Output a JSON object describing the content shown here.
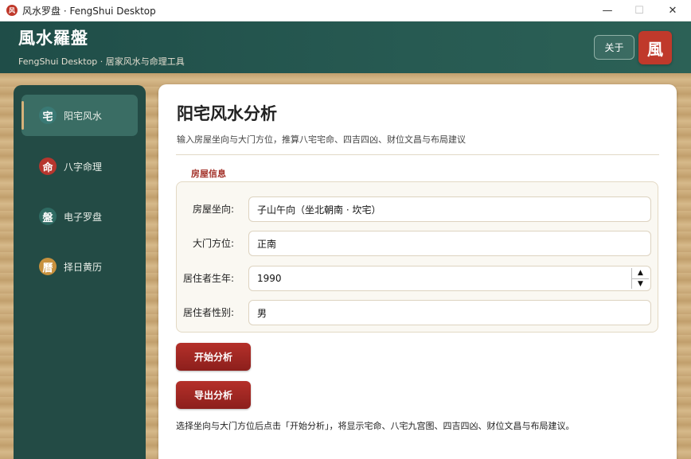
{
  "window": {
    "title": "风水罗盘 · FengShui Desktop",
    "icon_text": "风",
    "controls": {
      "minimize": "—",
      "maximize": "☐",
      "close": "✕"
    }
  },
  "header": {
    "brand": "風水羅盤",
    "subtitle": "FengShui Desktop · 居家风水与命理工具",
    "about_label": "关于",
    "seal_text": "風"
  },
  "sidebar": {
    "items": [
      {
        "icon": "宅",
        "label": "阳宅风水",
        "icon_color": "#3a7a75",
        "active": true
      },
      {
        "icon": "命",
        "label": "八字命理",
        "icon_color": "#b7362e",
        "active": false
      },
      {
        "icon": "盤",
        "label": "电子罗盘",
        "icon_color": "#2f6b63",
        "active": false
      },
      {
        "icon": "曆",
        "label": "择日黄历",
        "icon_color": "#c8913e",
        "active": false
      }
    ]
  },
  "main": {
    "title": "阳宅风水分析",
    "subtitle": "输入房屋坐向与大门方位，推算八宅宅命、四吉四凶、财位文昌与布局建议",
    "section_label": "房屋信息",
    "fields": {
      "orientation": {
        "label": "房屋坐向:",
        "value": "子山午向（坐北朝南 · 坎宅）"
      },
      "door": {
        "label": "大门方位:",
        "value": "正南"
      },
      "birth_year": {
        "label": "居住者生年:",
        "value": "1990"
      },
      "gender": {
        "label": "居住者性别:",
        "value": "男"
      }
    },
    "analyze_button": "开始分析",
    "export_button": "导出分析",
    "hint": "选择坐向与大门方位后点击「开始分析」，将显示宅命、八宅九宫图、四吉四凶、财位文昌与布局建议。"
  },
  "colors": {
    "header_bg": "#275a52",
    "sidebar_bg": "#234b45",
    "accent_red": "#a3322a",
    "button_red": "#8c1f1c"
  }
}
